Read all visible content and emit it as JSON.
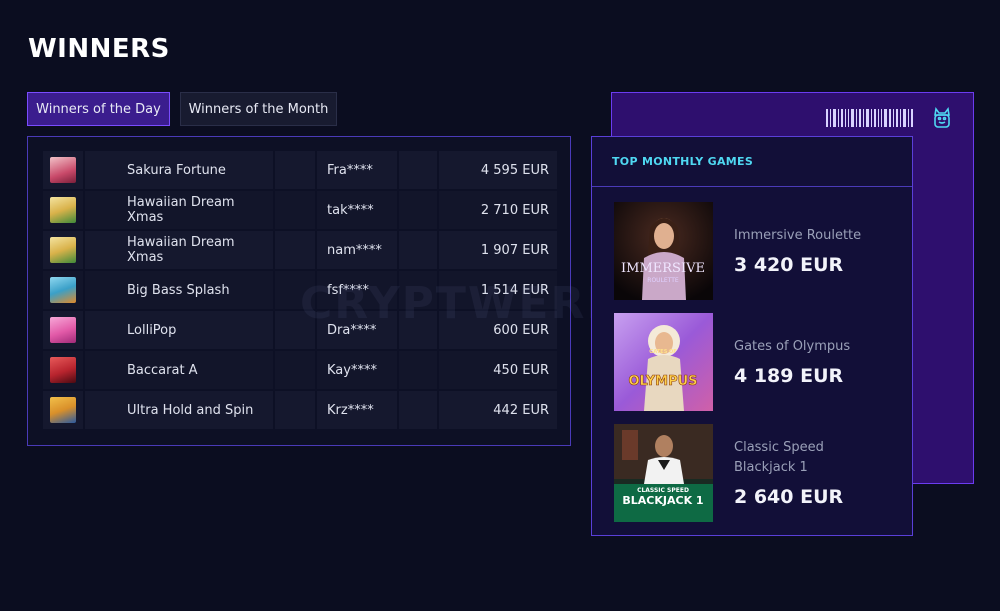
{
  "page": {
    "title": "WINNERS"
  },
  "tabs": {
    "day": "Winners of the Day",
    "month": "Winners of the Month"
  },
  "winners": [
    {
      "game": "Sakura Fortune",
      "user": "Fra****",
      "amount": "4 595 EUR",
      "thumb_color": "#c94a6a"
    },
    {
      "game": "Hawaiian Dream Xmas",
      "user": "tak****",
      "amount": "2 710 EUR",
      "thumb_color": "#d9b24a"
    },
    {
      "game": "Hawaiian Dream Xmas",
      "user": "nam****",
      "amount": "1 907 EUR",
      "thumb_color": "#d9b24a"
    },
    {
      "game": "Big Bass Splash",
      "user": "fsf****",
      "amount": "1 514 EUR",
      "thumb_color": "#3aa0c8"
    },
    {
      "game": "LolliPop",
      "user": "Dra****",
      "amount": "600 EUR",
      "thumb_color": "#e25aa8"
    },
    {
      "game": "Baccarat A",
      "user": "Kay****",
      "amount": "450 EUR",
      "thumb_color": "#b8242e"
    },
    {
      "game": "Ultra Hold and Spin",
      "user": "Krz****",
      "amount": "442 EUR",
      "thumb_color": "#d9902a"
    }
  ],
  "watermark": "CRYPTWERK.COM",
  "top_games": {
    "header": "TOP MONTHLY GAMES",
    "items": [
      {
        "name": "Immersive Roulette",
        "amount": "3 420 EUR",
        "img_text": "IMMERSIVE",
        "img_sub": "ROULETTE"
      },
      {
        "name": "Gates of Olympus",
        "amount": "4 189 EUR",
        "img_text": "OLYMPUS",
        "img_sub": "GATES OF"
      },
      {
        "name": "Classic Speed Blackjack 1",
        "amount": "2 640 EUR",
        "img_text": "BLACKJACK 1",
        "img_sub": "CLASSIC SPEED"
      }
    ]
  },
  "colors": {
    "accent": "#7a4cff",
    "header_cyan": "#4fd8f2",
    "card_purple": "#2e0f6e"
  }
}
